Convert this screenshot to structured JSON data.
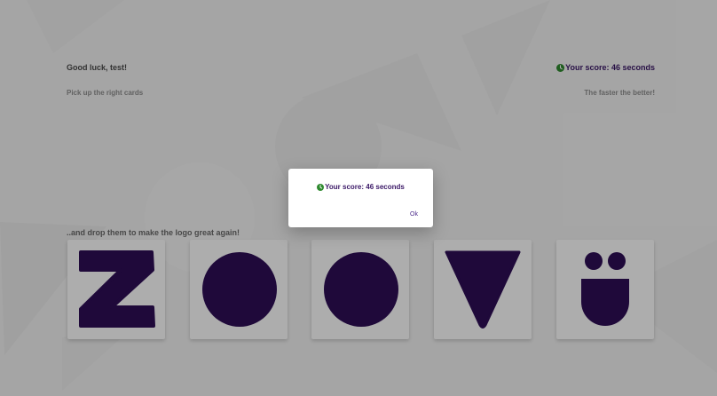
{
  "header": {
    "greeting": "Good luck, test!",
    "subtitle": "Pick up the right cards",
    "score": "Your score: 46 seconds",
    "tagline": "The faster the better!"
  },
  "drop_hint": "..and drop them to make the logo great again!",
  "cards": [
    {
      "shape": "letter-z-icon"
    },
    {
      "shape": "circle-icon"
    },
    {
      "shape": "circle-icon"
    },
    {
      "shape": "triangle-icon"
    },
    {
      "shape": "smiley-icon"
    }
  ],
  "dialog": {
    "score": "Your score: 46 seconds",
    "ok_label": "Ok"
  },
  "colors": {
    "brand": "#2e0e56",
    "clock": "#2f8a2f",
    "background": "#f4f4f4",
    "bg_shapes": "#ececec"
  }
}
